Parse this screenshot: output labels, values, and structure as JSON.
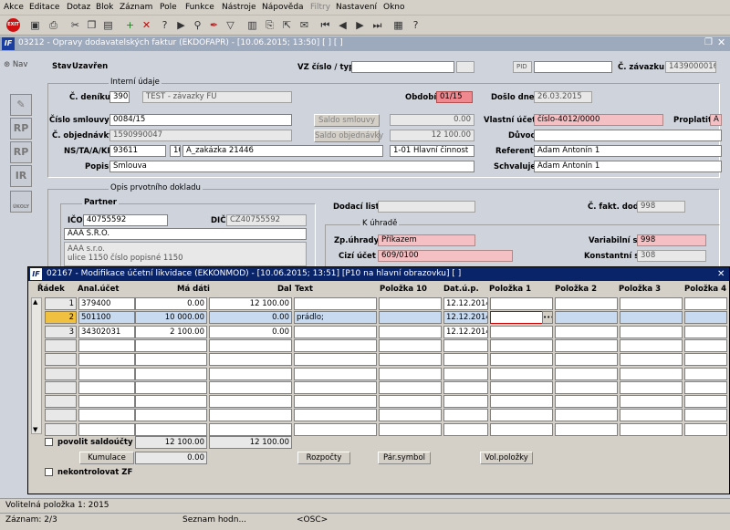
{
  "menu": [
    "Akce",
    "Editace",
    "Dotaz",
    "Blok",
    "Záznam",
    "Pole",
    "Funkce",
    "Nástroje",
    "Nápověda",
    "Filtry",
    "Nastavení",
    "Okno"
  ],
  "toolbar": {
    "exit_label": "EXIT"
  },
  "window": {
    "title": "03212 - Opravy dodavatelských faktur (EKDOFAPR) - [10.06.2015; 13:50]  [ ]  [ ]",
    "logo": "IF"
  },
  "nav": {
    "label": "Nav"
  },
  "side_icons": [
    "RP",
    "RP",
    "IR"
  ],
  "side_icon_last": "ÚKOLY",
  "header": {
    "stav_label": "Stav",
    "stav_value": "Uzavřen",
    "vz_label": "VZ číslo / typ",
    "pid_label": "PID",
    "c_zavazku_label": "Č. závazku",
    "c_zavazku_value": "1439000016",
    "interni_label": "Interní údaje",
    "c_deniku_label": "Č. deníku",
    "c_deniku_value": "390",
    "c_deniku_text": "TEST - závazky FÚ",
    "obdobi_label": "Období",
    "obdobi_value": "01/15",
    "doslo_label": "Došlo dne",
    "doslo_value": "26.03.2015",
    "cislo_smlouvy_label": "Číslo smlouvy",
    "cislo_smlouvy_value": "0084/15",
    "saldo_smlouvy_btn": "Saldo smlouvy",
    "saldo_smlouvy_value": "0.00",
    "vlastni_ucet_label": "Vlastní účet",
    "vlastni_ucet_value": "číslo-4012/0000",
    "proplatit_label": "Proplatit",
    "proplatit_value": "A",
    "c_objednavky_label": "Č. objednávky",
    "c_objednavky_value": "1590990047",
    "saldo_obj_btn": "Saldo objednávky",
    "saldo_obj_value": "12 100.00",
    "duvod_label": "Důvod",
    "ns_label": "NS/TA/A/KP",
    "ns_value": "93611",
    "ta_value": "10",
    "a_value": "A_zakázka 21446",
    "kp_value": "1-01 Hlavní činnost",
    "referent_label": "Referent",
    "referent_value": "Adam Antonín 1",
    "popis_label": "Popis",
    "popis_value": "Smlouva",
    "schvaluje_label": "Schvaluje",
    "schvaluje_value": "Adam Antonín 1",
    "opis_label": "Opis prvotního dokladu",
    "partner_label": "Partner",
    "dodaci_label": "Dodací list",
    "c_fakt_label": "Č. fakt. dod.",
    "c_fakt_value": "998",
    "ico_label": "IČO",
    "ico_value": "40755592",
    "dic_label": "DIČ",
    "dic_value": "CZ40755592",
    "partner_name": "AAA S.R.O.",
    "partner_addr1": "AAA s.r.o.",
    "partner_addr2": "ulice 1150 číslo popisné 1150",
    "k_uhrade_label": "K úhradě",
    "zp_uhrady_label": "Zp.úhrady",
    "zp_uhrady_value": "Příkazem",
    "variabilni_label": "Variabilní s.",
    "variabilni_value": "998",
    "cizi_ucet_label": "Cizí účet",
    "cizi_ucet_value": "609/0100",
    "konstantni_label": "Konstantní s.",
    "konstantni_value": "308"
  },
  "modal": {
    "title": "02167 - Modifikace účetní likvidace (EKKONMOD) - [10.06.2015; 13:51]  [P10 na hlavní obrazovku]  [ ]",
    "logo": "IF",
    "columns": [
      "Řádek",
      "Anal.účet",
      "Má dáti",
      "Dal",
      "Text",
      "Položka 10",
      "Dat.ú.p.",
      "Položka 1",
      "Položka 2",
      "Položka 3",
      "Položka 4"
    ],
    "rows": [
      {
        "radek": "1",
        "ucet": "379400",
        "madati": "0.00",
        "dal": "12 100.00",
        "text": "",
        "datum": "12.12.2014"
      },
      {
        "radek": "2",
        "ucet": "501100",
        "madati": "10 000.00",
        "dal": "0.00",
        "text": "prádlo;",
        "datum": "12.12.2014"
      },
      {
        "radek": "3",
        "ucet": "34302031",
        "madati": "2 100.00",
        "dal": "0.00",
        "text": "",
        "datum": "12.12.2014"
      }
    ],
    "povolit_label": "povolit saldoúčty",
    "sum_madati": "12 100.00",
    "sum_dal": "12 100.00",
    "kumulace_btn": "Kumulace",
    "kumulace_value": "0.00",
    "rozpocty_btn": "Rozpočty",
    "par_symbol_btn": "Pár.symbol",
    "vol_polozky_btn": "Vol.položky",
    "nekontrolovat_label": "nekontrolovat ZF"
  },
  "status": {
    "line1": "Volitelná položka 1: 2015",
    "zaznam": "Záznam: 2/3",
    "seznam": "Seznam hodn...",
    "osc": "<OSC>"
  }
}
